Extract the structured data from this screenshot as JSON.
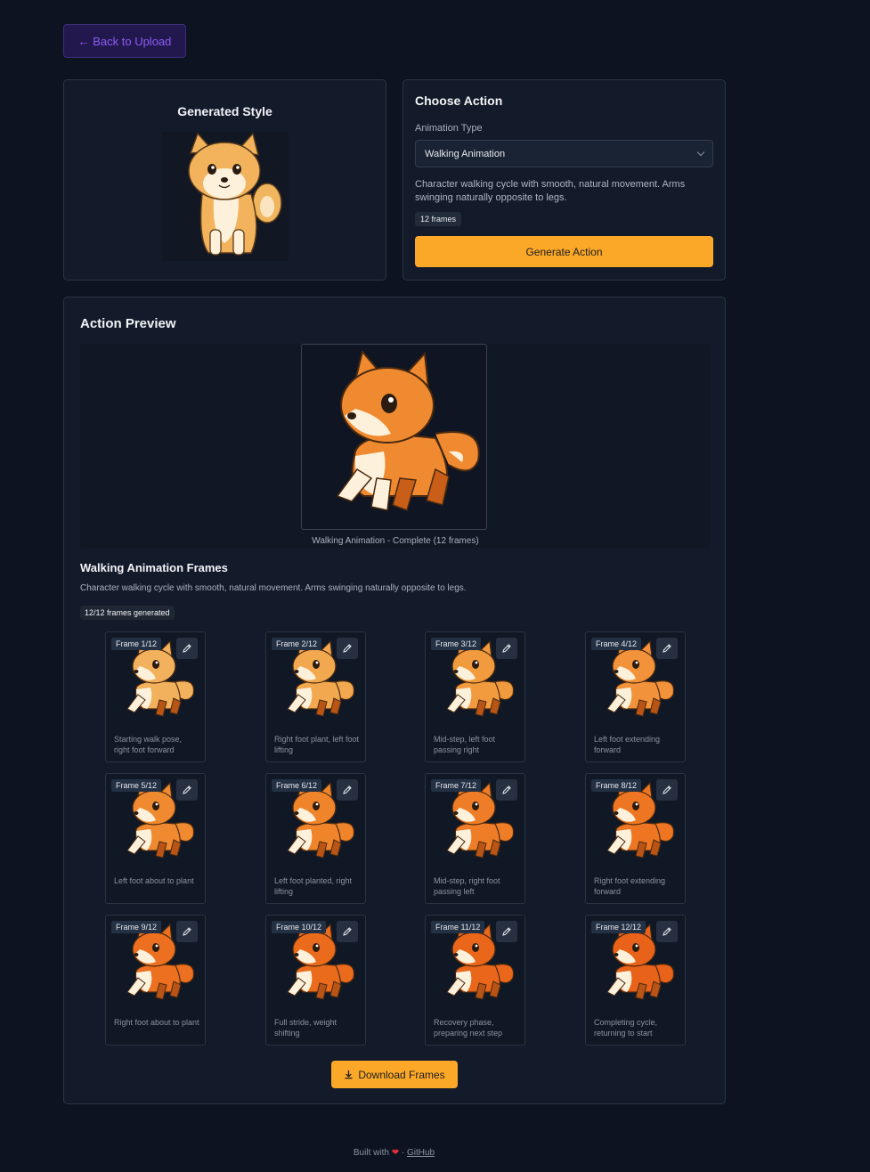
{
  "nav": {
    "back_label": "← Back to Upload"
  },
  "style_card": {
    "title": "Generated Style"
  },
  "action_card": {
    "title": "Choose Action",
    "type_label": "Animation Type",
    "selected_type": "Walking Animation",
    "description": "Character walking cycle with smooth, natural movement. Arms swinging naturally opposite to legs.",
    "frames_badge": "12 frames",
    "generate_label": "Generate Action"
  },
  "preview": {
    "title": "Action Preview",
    "caption": "Walking Animation - Complete (12 frames)",
    "frames_title": "Walking Animation Frames",
    "frames_description": "Character walking cycle with smooth, natural movement. Arms swinging naturally opposite to legs.",
    "frames_generated": "12/12 frames generated",
    "download_label": "Download Frames"
  },
  "frames": [
    {
      "tag": "Frame 1/12",
      "desc": "Starting walk pose, right foot forward",
      "tone": "#f2b15c"
    },
    {
      "tag": "Frame 2/12",
      "desc": "Right foot plant, left foot lifting",
      "tone": "#f2a84f"
    },
    {
      "tag": "Frame 3/12",
      "desc": "Mid-step, left foot passing right",
      "tone": "#f29a3e"
    },
    {
      "tag": "Frame 4/12",
      "desc": "Left foot extending forward",
      "tone": "#f2923a"
    },
    {
      "tag": "Frame 5/12",
      "desc": "Left foot about to plant",
      "tone": "#f08a30"
    },
    {
      "tag": "Frame 6/12",
      "desc": "Left foot planted, right lifting",
      "tone": "#f0842b"
    },
    {
      "tag": "Frame 7/12",
      "desc": "Mid-step, right foot passing left",
      "tone": "#ef7c27"
    },
    {
      "tag": "Frame 8/12",
      "desc": "Right foot extending forward",
      "tone": "#ee7622"
    },
    {
      "tag": "Frame 9/12",
      "desc": "Right foot about to plant",
      "tone": "#ec701f"
    },
    {
      "tag": "Frame 10/12",
      "desc": "Full stride, weight shifting",
      "tone": "#eb6b1d"
    },
    {
      "tag": "Frame 11/12",
      "desc": "Recovery phase, preparing next step",
      "tone": "#ea661b"
    },
    {
      "tag": "Frame 12/12",
      "desc": "Completing cycle, returning to start",
      "tone": "#e9621a"
    }
  ],
  "footer": {
    "built_with": "Built with",
    "separator": "·",
    "github_label": "GitHub"
  }
}
